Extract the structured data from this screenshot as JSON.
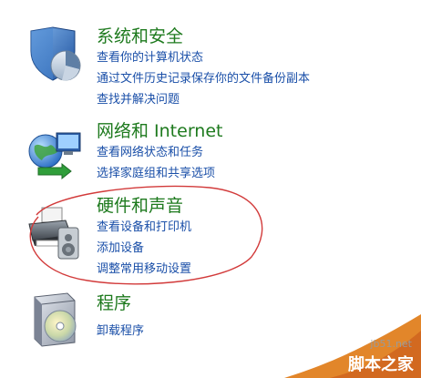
{
  "categories": [
    {
      "title": "系统和安全",
      "icon": "shield-pie-chart-icon",
      "links": [
        "查看你的计算机状态",
        "通过文件历史记录保存你的文件备份副本",
        "查找并解决问题"
      ]
    },
    {
      "title": "网络和 Internet",
      "icon": "network-globe-icon",
      "links": [
        "查看网络状态和任务",
        "选择家庭组和共享选项"
      ]
    },
    {
      "title": "硬件和声音",
      "icon": "printer-speaker-icon",
      "links": [
        "查看设备和打印机",
        "添加设备",
        "调整常用移动设置"
      ]
    },
    {
      "title": "程序",
      "icon": "program-disc-icon",
      "links": [
        "卸载程序"
      ]
    }
  ],
  "watermark": {
    "site": "jb51.net",
    "brand": "脚本之家"
  },
  "colors": {
    "title": "#1e7a1e",
    "link": "#1a4fa8",
    "highlight": "#d23a3a"
  }
}
